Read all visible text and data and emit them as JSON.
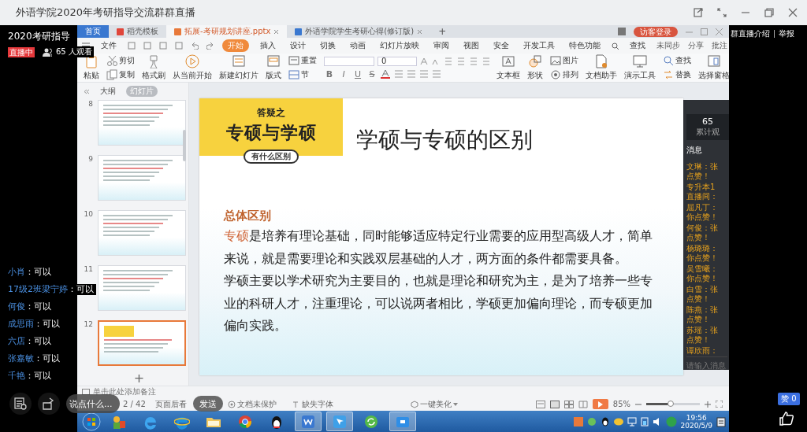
{
  "window": {
    "title": "外语学院2020年考研指导交流群群直播"
  },
  "live": {
    "channel": "2020考研指导",
    "status": "直播中",
    "viewers": "65 人观看",
    "chat": [
      {
        "name": "小肖",
        "message": "：可以"
      },
      {
        "name": "17级2班梁宁婷",
        "message": "：可以"
      },
      {
        "name": "何俊",
        "message": "：可以"
      },
      {
        "name": "成思雨",
        "message": "：可以"
      },
      {
        "name": "六店",
        "message": "：可以"
      },
      {
        "name": "张嘉敏",
        "message": "：可以"
      },
      {
        "name": "千艳",
        "message": "：可以"
      }
    ],
    "placeholder": "说点什么...",
    "send": "发送"
  },
  "side": {
    "links": [
      "群直播介绍",
      "举报"
    ],
    "likes": "赞 0"
  },
  "wps": {
    "tabs": [
      {
        "label": "首页",
        "kind": "home",
        "selected": false
      },
      {
        "label": "稻壳模板",
        "kind": "docer",
        "selected": false
      },
      {
        "label": "拓展-考研规划讲座.pptx",
        "kind": "presentation",
        "selected": true
      },
      {
        "label": "外语学院学生考研心得(修订版)",
        "kind": "document",
        "selected": false
      }
    ],
    "new_tab": "+",
    "login": "访客登录",
    "menu": [
      {
        "label": "文件",
        "selected": false
      },
      {
        "label": "开始",
        "selected": true
      },
      {
        "label": "插入",
        "selected": false
      },
      {
        "label": "设计",
        "selected": false
      },
      {
        "label": "切换",
        "selected": false
      },
      {
        "label": "动画",
        "selected": false
      },
      {
        "label": "幻灯片放映",
        "selected": false
      },
      {
        "label": "审阅",
        "selected": false
      },
      {
        "label": "视图",
        "selected": false
      },
      {
        "label": "安全",
        "selected": false
      },
      {
        "label": "开发工具",
        "selected": false
      },
      {
        "label": "特色功能",
        "selected": false
      },
      {
        "label": "查找",
        "selected": false
      }
    ],
    "toolbar_right": [
      "未同步",
      "分享",
      "批注"
    ],
    "ribbon": [
      {
        "kind": "big",
        "label": "粘贴"
      },
      {
        "kind": "stack",
        "items": [
          {
            "label": "剪切"
          },
          {
            "label": "复制"
          }
        ]
      },
      {
        "kind": "big",
        "label": "格式刷"
      },
      {
        "kind": "big",
        "label": "从当前开始"
      },
      {
        "kind": "big",
        "label": "新建幻灯片"
      },
      {
        "kind": "big",
        "label": "版式"
      },
      {
        "kind": "stack",
        "items": [
          {
            "label": "重置"
          },
          {
            "label": "节"
          }
        ]
      },
      {
        "kind": "font",
        "size": "0",
        "styles": [
          "B",
          "I",
          "U",
          "S"
        ]
      },
      {
        "kind": "big",
        "label": "文本框"
      },
      {
        "kind": "big",
        "label": "形状"
      },
      {
        "kind": "stack",
        "items": [
          {
            "label": "图片"
          },
          {
            "label": "排列"
          }
        ]
      },
      {
        "kind": "big",
        "label": "文档助手"
      },
      {
        "kind": "big",
        "label": "演示工具"
      },
      {
        "kind": "stack",
        "items": [
          {
            "label": "查找"
          },
          {
            "label": "替换"
          }
        ]
      },
      {
        "kind": "big",
        "label": "选择窗格"
      }
    ],
    "panel_tabs": [
      {
        "label": "大纲",
        "selected": false
      },
      {
        "label": "幻灯片",
        "selected": true
      }
    ],
    "slides": [
      {
        "number": "8",
        "selected": false
      },
      {
        "number": "9",
        "selected": false
      },
      {
        "number": "10",
        "selected": false
      },
      {
        "number": "11",
        "selected": false
      },
      {
        "number": "12",
        "selected": true
      }
    ],
    "add_slide": "+",
    "slide": {
      "banner": {
        "top": "答疑之",
        "main": "专硕与学硕",
        "tag": "有什么区别"
      },
      "title": "学硕与专硕的区别",
      "heading": "总体区别",
      "paragraphs": [
        {
          "lead": "专硕",
          "text": "是培养有理论基础，同时能够适应特定行业需要的应用型高级人才，简单来说，就是需要理论和实践双层基础的人才，两方面的条件都需要具备。"
        },
        {
          "text": "学硕主要以学术研究为主要目的，也就是理论和研究为主，是为了培养一些专业的科研人才，注重理论，可以说两者相比，学硕更加偏向理论，而专硕更加偏向实践。"
        }
      ]
    },
    "live_panel": {
      "count": "65",
      "count_label": "累计观",
      "title": "消息",
      "messages": [
        {
          "lines": [
            "文琳：张",
            "点赞！"
          ]
        },
        {
          "lines": [
            "专升本1",
            "直播间："
          ]
        },
        {
          "lines": [
            "屈凡丁：",
            "你点赞！"
          ]
        },
        {
          "lines": [
            "何俊：张",
            "点赞！"
          ]
        },
        {
          "lines": [
            "杨璐璐：",
            "你点赞！"
          ]
        },
        {
          "lines": [
            "吴雪曦：",
            "你点赞！"
          ]
        },
        {
          "lines": [
            "白雪：张",
            "点赞！"
          ]
        },
        {
          "lines": [
            "陈燕：张",
            "点赞！"
          ]
        },
        {
          "lines": [
            "苏瑶：张",
            "点赞！"
          ]
        },
        {
          "lines": [
            "谭欣雨："
          ]
        }
      ],
      "placeholder": "请输入消息"
    },
    "notes_placeholder": "单击此处添加备注",
    "status": {
      "page": "2 / 42",
      "items": [
        "页面后看",
        "文档未保护",
        "缺失字体"
      ],
      "beautify": "一键美化",
      "zoom": "85%"
    },
    "zoom_slider": {
      "level": 0.45
    }
  },
  "taskbar": {
    "time": "19:56",
    "date": "2020/5/9"
  }
}
